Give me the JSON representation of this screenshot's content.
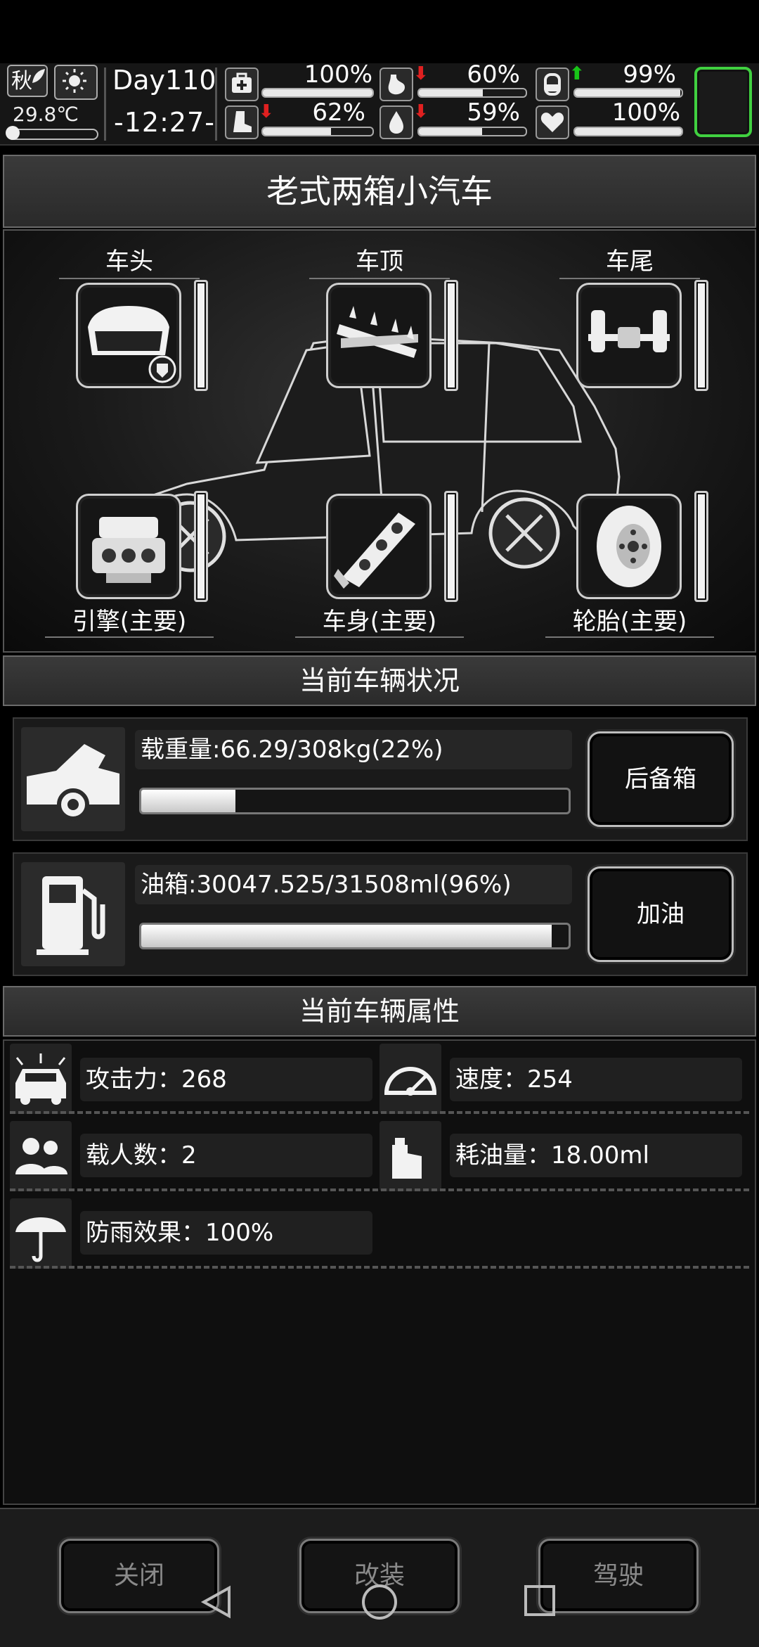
{
  "hud": {
    "season": "秋",
    "temperature": "29.8℃",
    "day": "Day110",
    "time": "-12:27-",
    "stats": [
      {
        "icon": "medkit-icon",
        "value": "100%",
        "level": 1.0,
        "trend": ""
      },
      {
        "icon": "stomach-icon",
        "value": "60%",
        "level": 0.6,
        "trend": "down"
      },
      {
        "icon": "lungs-icon",
        "value": "99%",
        "level": 0.99,
        "trend": "up"
      },
      {
        "icon": "boot-icon",
        "value": "62%",
        "level": 0.62,
        "trend": "down"
      },
      {
        "icon": "water-drop-icon",
        "value": "59%",
        "level": 0.59,
        "trend": "down"
      },
      {
        "icon": "heart-icon",
        "value": "100%",
        "level": 1.0,
        "trend": ""
      }
    ]
  },
  "vehicle": {
    "name": "老式两箱小汽车",
    "slots_top": [
      {
        "label": "车头",
        "icon": "car-hood-icon",
        "level": 1.0
      },
      {
        "label": "车顶",
        "icon": "roof-spikes-icon",
        "level": 1.0
      },
      {
        "label": "车尾",
        "icon": "rear-axle-icon",
        "level": 1.0
      }
    ],
    "slots_bottom": [
      {
        "label": "引擎(主要)",
        "icon": "engine-icon",
        "level": 1.0
      },
      {
        "label": "车身(主要)",
        "icon": "chassis-icon",
        "level": 1.0
      },
      {
        "label": "轮胎(主要)",
        "icon": "tire-icon",
        "level": 1.0
      }
    ]
  },
  "status": {
    "title": "当前车辆状况",
    "load_text": "载重量:66.29/308kg(22%)",
    "load_fraction": 0.22,
    "trunk_button": "后备箱",
    "fuel_text": "油箱:30047.525/31508ml(96%)",
    "fuel_fraction": 0.96,
    "refuel_button": "加油"
  },
  "attributes": {
    "title": "当前车辆属性",
    "attack": "攻击力：268",
    "speed": "速度：254",
    "passengers": "载人数：2",
    "fuel_use": "耗油量：18.00ml",
    "rain": "防雨效果：100%"
  },
  "buttons": {
    "close": "关闭",
    "modify": "改装",
    "drive": "驾驶"
  }
}
